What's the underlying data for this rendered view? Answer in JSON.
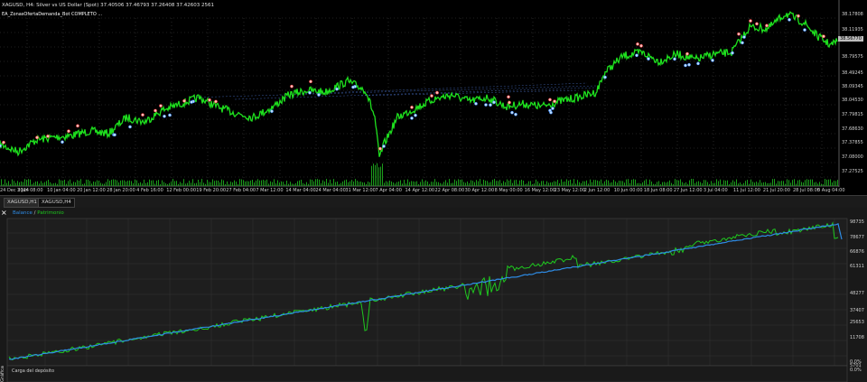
{
  "header": {
    "symbol_line": "XAGUSD, H4:  Silver vs US Dollar (Spot)  37.40506 37.46793 37.26408 37.42603  2561",
    "ea_line": "EA_ZonasOfertaDemanda_Bot COMPLETO  ..."
  },
  "top_chart": {
    "price_labels": [
      "38.17808",
      "38.11935",
      "38.79575",
      "38.49245",
      "38.09345",
      "38.04530",
      "37.79815",
      "37.68630",
      "37.37855",
      "37.08000",
      "37.27525"
    ],
    "current_price": "38.56770",
    "x_labels": [
      "24 Dec 2024",
      "3 Jan 08:00",
      "10 Jan 04:00",
      "20 Jan 12:00",
      "28 Jan 20:00",
      "4 Feb 16:00",
      "12 Feb 00:00",
      "19 Feb 20:00",
      "27 Feb 04:00",
      "7 Mar 12:00",
      "14 Mar 04:00",
      "24 Mar 04:00",
      "31 Mar 12:00",
      "7 Apr 04:00",
      "14 Apr 12:00",
      "22 Apr 08:00",
      "30 Apr 12:00",
      "8 May 00:00",
      "16 May 12:00",
      "23 May 12:00",
      "2 Jun 12:00",
      "10 Jun 00:00",
      "18 Jun 08:00",
      "27 Jun 12:00",
      "3 Jul 04:00",
      "11 Jul 12:00",
      "21 Jul 20:00",
      "28 Jul 08:00",
      "5 Aug 04:00"
    ],
    "colors": {
      "price": "#1ee01e",
      "grid": "#404040",
      "volume": "#1c9c1c"
    }
  },
  "tabs": [
    {
      "label": "XAGUSD,H1"
    },
    {
      "label": "XAGUSD,H4"
    }
  ],
  "bottom_panel": {
    "close_icon": "×",
    "legend_balance": "Balance",
    "legend_sep": " / ",
    "legend_equity": "Patrimonio",
    "y_labels": [
      "98735",
      "78677",
      "66876",
      "61311",
      "48277",
      "37407",
      "25653",
      "11708",
      "5701"
    ],
    "pct_labels": [
      "0.0%",
      "0.0%"
    ],
    "load_label": "Carga del depósito",
    "side_label": "Gráfica",
    "colors": {
      "balance": "#2e8ce6",
      "equity": "#1ec81e",
      "background": "#191919"
    }
  }
}
